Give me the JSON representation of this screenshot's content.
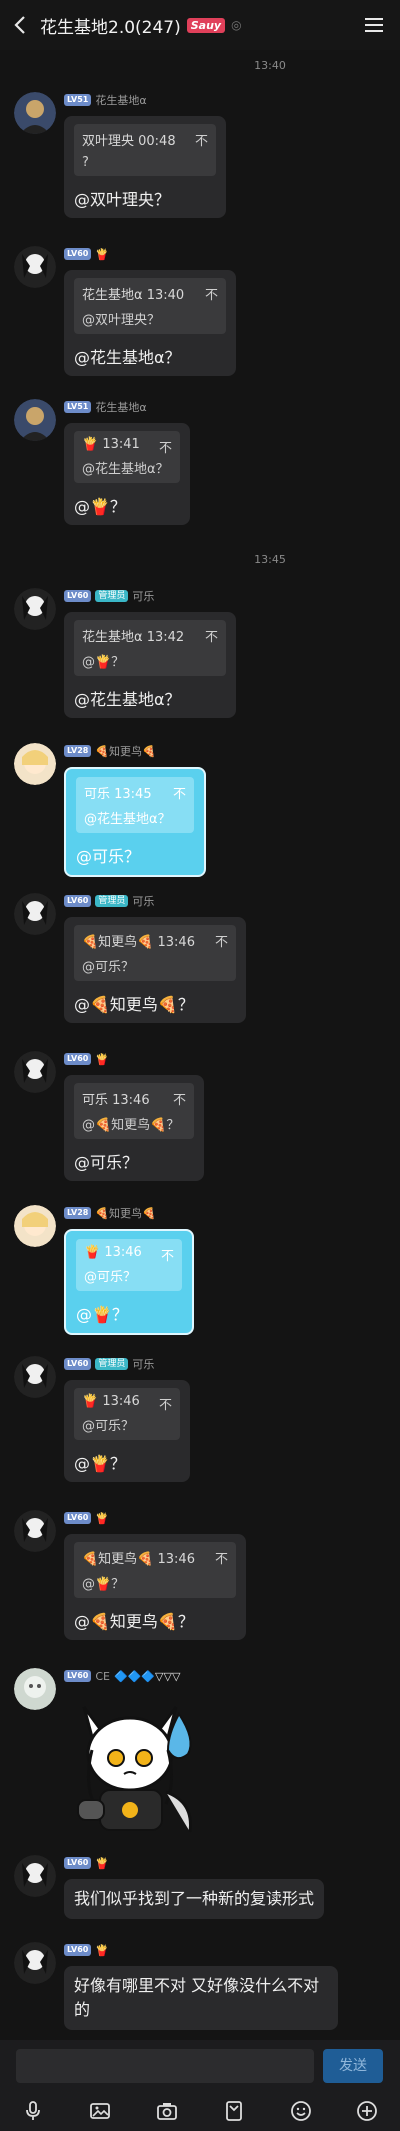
{
  "header": {
    "title": "花生基地2.0(247)",
    "badge": "Sauy"
  },
  "times": [
    "13:40",
    "13:45"
  ],
  "messages": [
    {
      "lv": "LV51",
      "nick": "花生基地α",
      "quote_head": "双叶理央 00:48",
      "quote_body": "?",
      "close": "不",
      "text": "@双叶理央？"
    },
    {
      "lv": "LV60",
      "nick": "🍟",
      "quote_head": "花生基地α 13:40",
      "quote_body": "@双叶理央？",
      "close": "不",
      "text": "@花生基地α？"
    },
    {
      "lv": "LV51",
      "nick": "花生基地α",
      "quote_head": "🍟 13:41",
      "quote_body": "@花生基地α？",
      "close": "不",
      "text": "@🍟？"
    },
    {
      "lv": "LV60",
      "role": "管理员",
      "nick": "可乐",
      "quote_head": "花生基地α 13:42",
      "quote_body": "@🍟？",
      "close": "不",
      "text": "@花生基地α？"
    },
    {
      "lv": "LV28",
      "nick": "🍕知更鸟🍕",
      "quote_head": "可乐 13:45",
      "quote_body": "@花生基地α？",
      "close": "不",
      "text": "@可乐？"
    },
    {
      "lv": "LV60",
      "role": "管理员",
      "nick": "可乐",
      "quote_head": "🍕知更鸟🍕 13:46",
      "quote_body": "@可乐？",
      "close": "不",
      "text": "@🍕知更鸟🍕？"
    },
    {
      "lv": "LV60",
      "nick": "🍟",
      "quote_head": "可乐 13:46",
      "quote_body": "@🍕知更鸟🍕？",
      "close": "不",
      "text": "@可乐？"
    },
    {
      "lv": "LV28",
      "nick": "🍕知更鸟🍕",
      "quote_head": "🍟 13:46",
      "quote_body": "@可乐？",
      "close": "不",
      "text": "@🍟？"
    },
    {
      "lv": "LV60",
      "role": "管理员",
      "nick": "可乐",
      "quote_head": "🍟 13:46",
      "quote_body": "@可乐？",
      "close": "不",
      "text": "@🍟？"
    },
    {
      "lv": "LV60",
      "nick": "🍟",
      "quote_head": "🍕知更鸟🍕 13:46",
      "quote_body": "@🍟？",
      "close": "不",
      "text": "@🍕知更鸟🍕？"
    },
    {
      "lv": "LV60",
      "nick": "CE",
      "extra": "🔷🔷🔷▽▽▽"
    },
    {
      "lv": "LV60",
      "nick": "🍟",
      "text": "我们似乎找到了一种新的复读形式"
    },
    {
      "lv": "LV60",
      "nick": "🍟",
      "text": "好像有哪里不对 又好像没什么不对的"
    }
  ],
  "composer": {
    "send_label": "发送"
  },
  "icons": [
    "back-icon",
    "menu-icon",
    "mic-icon",
    "image-icon",
    "camera-icon",
    "file-icon",
    "emoji-icon",
    "plus-icon"
  ]
}
